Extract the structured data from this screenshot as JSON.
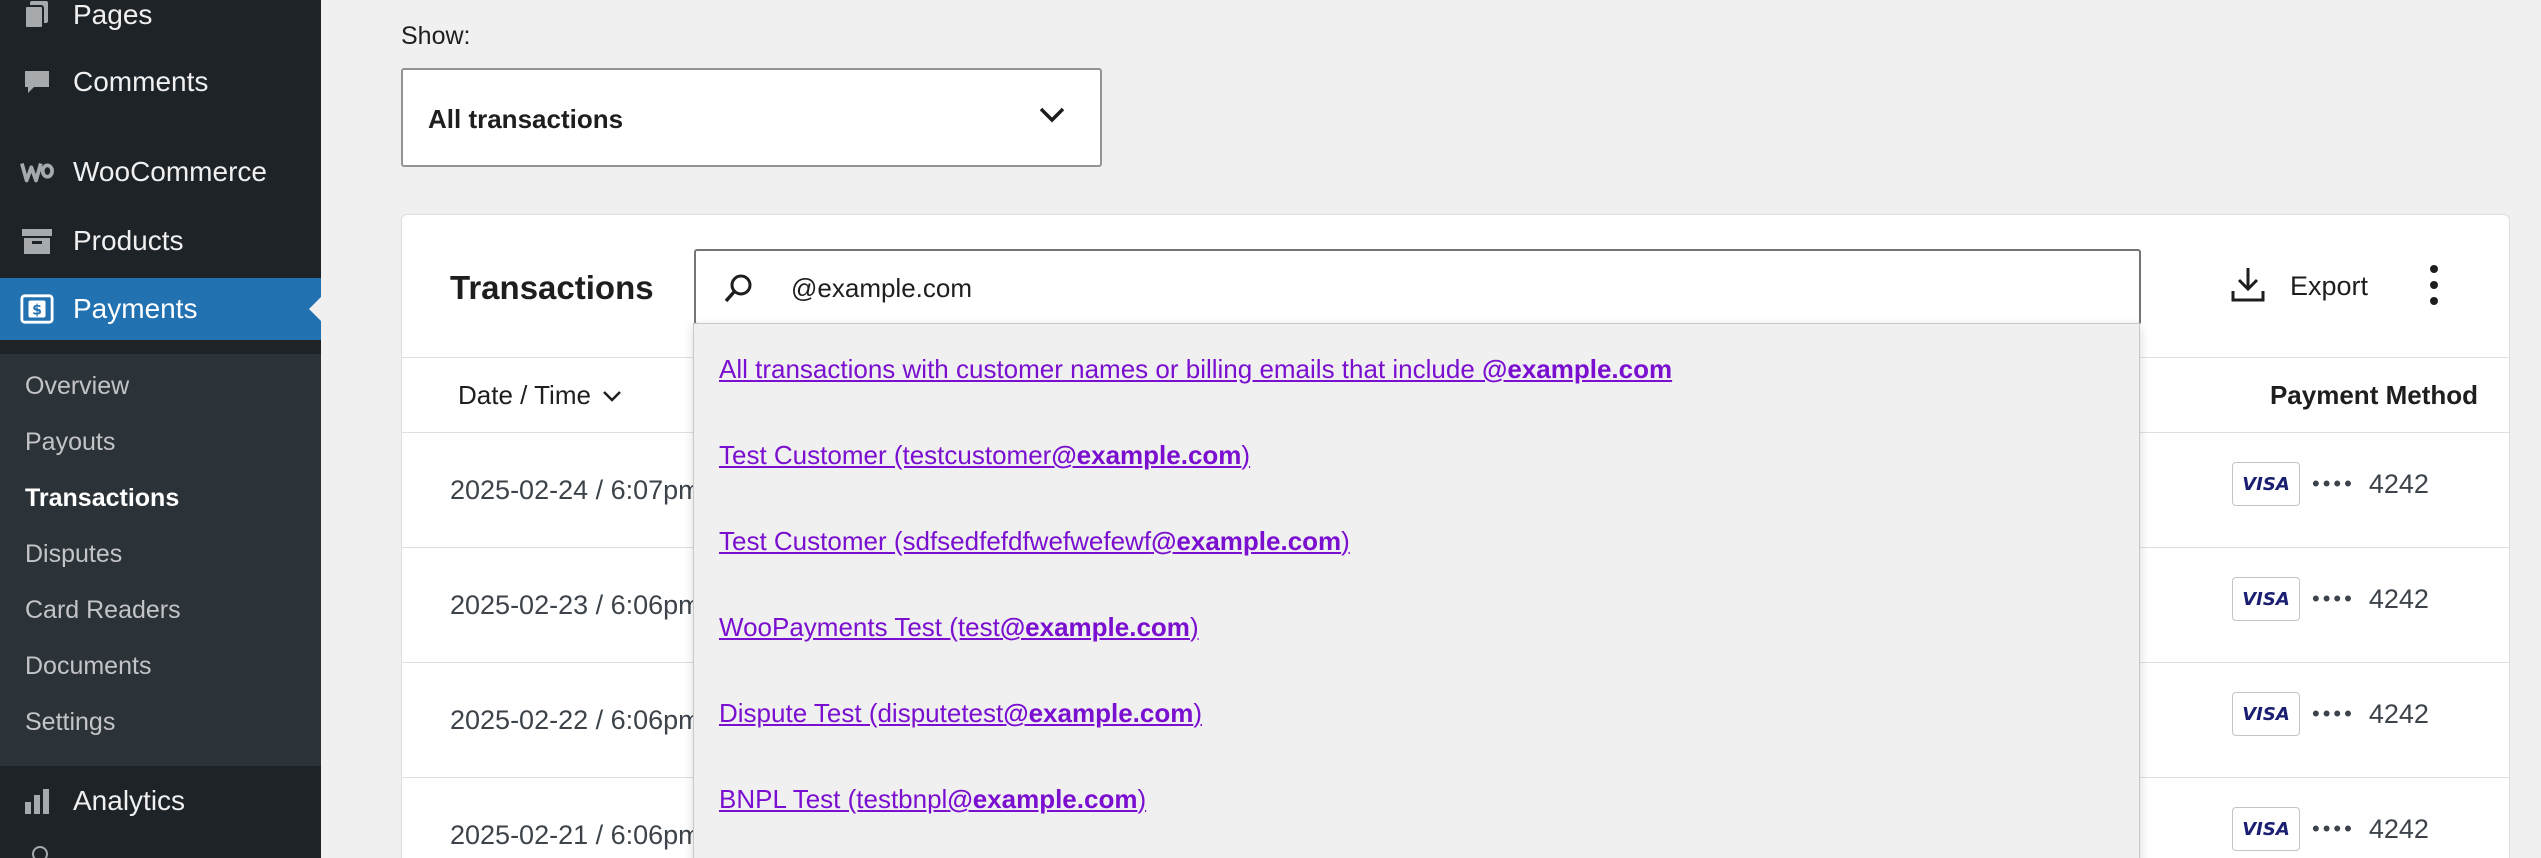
{
  "sidebar": {
    "items": [
      {
        "label": "Pages",
        "icon": "pages-icon"
      },
      {
        "label": "Comments",
        "icon": "comments-icon"
      },
      {
        "label": "WooCommerce",
        "icon": "woocommerce-icon"
      },
      {
        "label": "Products",
        "icon": "products-icon"
      },
      {
        "label": "Payments",
        "icon": "payments-icon"
      },
      {
        "label": "Analytics",
        "icon": "analytics-icon"
      }
    ],
    "submenu": [
      "Overview",
      "Payouts",
      "Transactions",
      "Disputes",
      "Card Readers",
      "Documents",
      "Settings"
    ],
    "current_submenu": "Transactions"
  },
  "filter": {
    "label": "Show:",
    "value": "All transactions"
  },
  "card": {
    "title": "Transactions",
    "search_value": "@example.com",
    "export_label": "Export"
  },
  "table": {
    "columns": {
      "date": "Date / Time",
      "payment_method": "Payment Method"
    },
    "rows": [
      {
        "date": "2025-02-24 / 6:07pm",
        "brand": "VISA",
        "dots": "••••",
        "last4": "4242"
      },
      {
        "date": "2025-02-23 / 6:06pm",
        "brand": "VISA",
        "dots": "••••",
        "last4": "4242"
      },
      {
        "date": "2025-02-22 / 6:06pm",
        "brand": "VISA",
        "dots": "••••",
        "last4": "4242"
      },
      {
        "date": "2025-02-21 / 6:06pm",
        "brand": "VISA",
        "dots": "••••",
        "last4": "4242"
      }
    ]
  },
  "suggestions": [
    {
      "prefix": "All transactions with customer names or billing emails that include ",
      "match": "@example.com",
      "suffix": ""
    },
    {
      "prefix": "Test Customer (testcustomer",
      "match": "@example.com",
      "suffix": ")"
    },
    {
      "prefix": "Test Customer (sdfsedfefdfwefwefewf",
      "match": "@example.com",
      "suffix": ")"
    },
    {
      "prefix": "WooPayments Test (test",
      "match": "@example.com",
      "suffix": ")"
    },
    {
      "prefix": "Dispute Test (disputetest",
      "match": "@example.com",
      "suffix": ")"
    },
    {
      "prefix": "BNPL Test (testbnpl",
      "match": "@example.com",
      "suffix": ")"
    }
  ],
  "colors": {
    "sidebar": "#1d2327",
    "active": "#2271b1",
    "link": "#7b0fd0"
  }
}
